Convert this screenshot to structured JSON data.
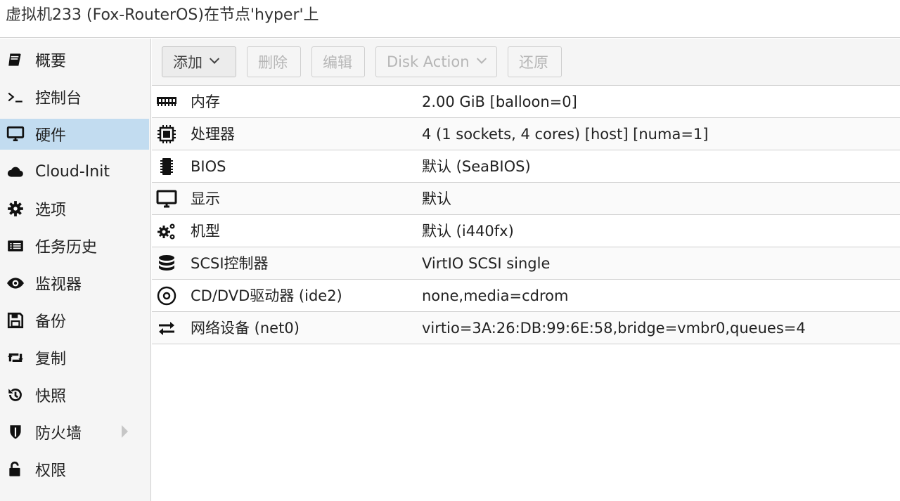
{
  "window": {
    "title": "虚拟机233 (Fox-RouterOS)在节点'hyper'上"
  },
  "sidebar": {
    "items": [
      {
        "label": "概要",
        "icon": "book-icon"
      },
      {
        "label": "控制台",
        "icon": "terminal-icon"
      },
      {
        "label": "硬件",
        "icon": "desktop-icon",
        "active": true
      },
      {
        "label": "Cloud-Init",
        "icon": "cloud-icon"
      },
      {
        "label": "选项",
        "icon": "gear-icon"
      },
      {
        "label": "任务历史",
        "icon": "list-icon"
      },
      {
        "label": "监视器",
        "icon": "eye-icon"
      },
      {
        "label": "备份",
        "icon": "floppy-icon"
      },
      {
        "label": "复制",
        "icon": "retweet-icon"
      },
      {
        "label": "快照",
        "icon": "history-icon"
      },
      {
        "label": "防火墙",
        "icon": "shield-icon",
        "has_submenu": true
      },
      {
        "label": "权限",
        "icon": "unlock-icon"
      }
    ]
  },
  "toolbar": {
    "add_label": "添加",
    "delete_label": "删除",
    "edit_label": "编辑",
    "disk_action_label": "Disk Action",
    "revert_label": "还原"
  },
  "hardware": {
    "rows": [
      {
        "name": "内存",
        "value": "2.00 GiB [balloon=0]",
        "icon": "memory-icon"
      },
      {
        "name": "处理器",
        "value": "4 (1 sockets, 4 cores) [host] [numa=1]",
        "icon": "cpu-icon"
      },
      {
        "name": "BIOS",
        "value": "默认 (SeaBIOS)",
        "icon": "microchip-icon"
      },
      {
        "name": "显示",
        "value": "默认",
        "icon": "desktop-icon"
      },
      {
        "name": "机型",
        "value": "默认 (i440fx)",
        "icon": "cogs-icon"
      },
      {
        "name": "SCSI控制器",
        "value": "VirtIO SCSI single",
        "icon": "database-icon"
      },
      {
        "name": "CD/DVD驱动器 (ide2)",
        "value": "none,media=cdrom",
        "icon": "cdrom-icon"
      },
      {
        "name": "网络设备 (net0)",
        "value": "virtio=3A:26:DB:99:6E:58,bridge=vmbr0,queues=4",
        "icon": "exchange-icon"
      }
    ]
  },
  "colors": {
    "selected_nav": "#c2dcf0",
    "sidebar_bg": "#f5f5f5",
    "border": "#cfcfcf"
  }
}
